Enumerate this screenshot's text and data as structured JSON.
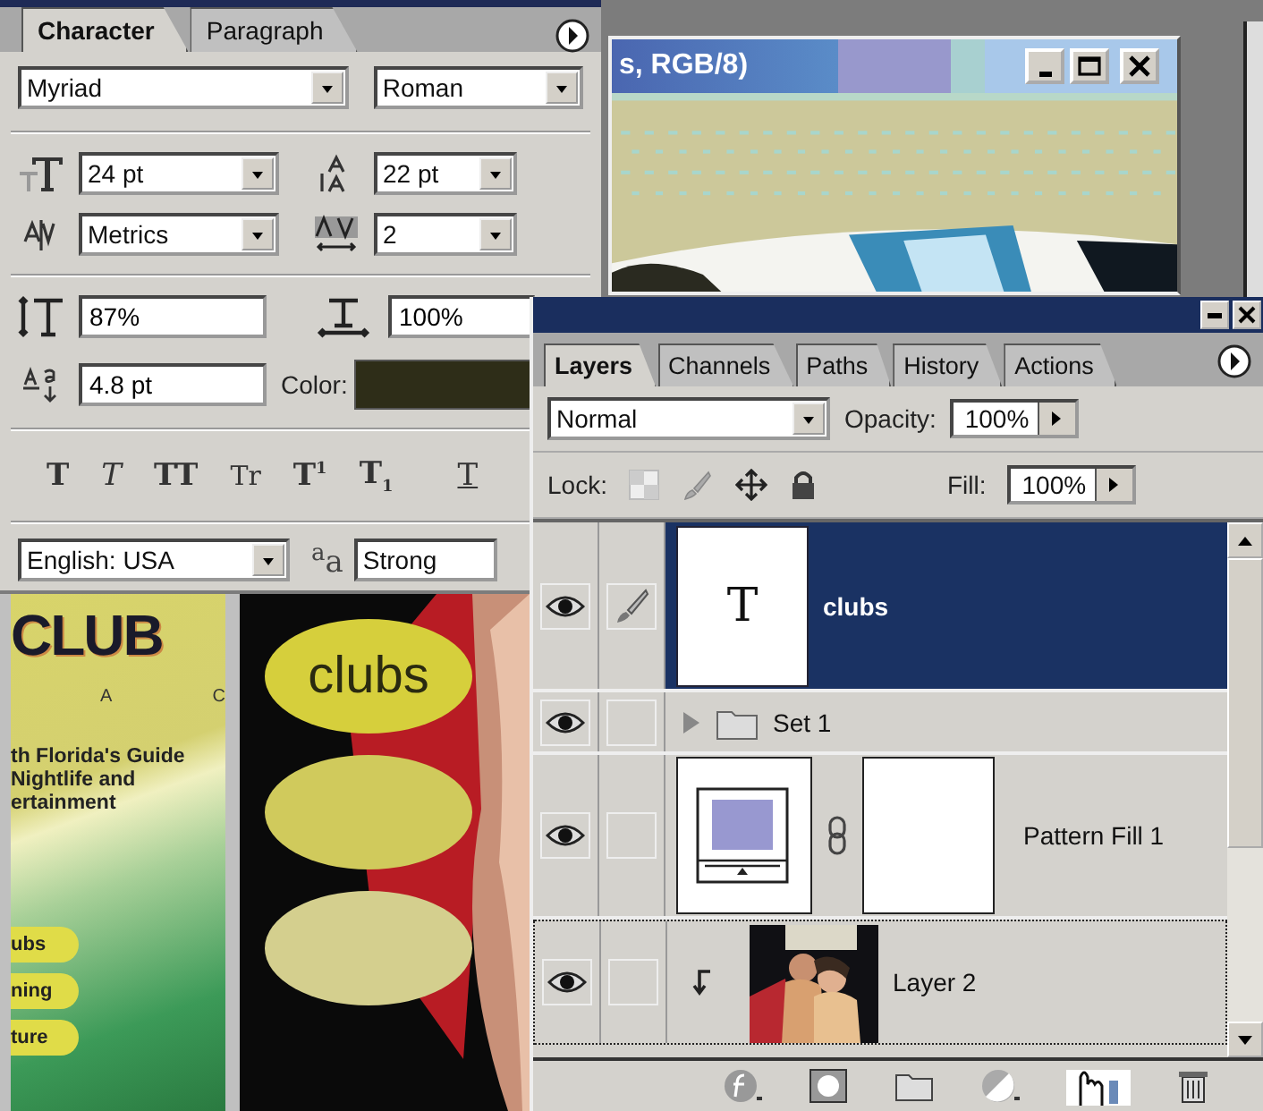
{
  "character_panel": {
    "tabs": [
      {
        "label": "Character",
        "selected": true
      },
      {
        "label": "Paragraph",
        "selected": false
      }
    ],
    "font_family": "Myriad",
    "font_style": "Roman",
    "size": "24 pt",
    "leading": "22 pt",
    "kerning": "Metrics",
    "tracking": "2",
    "vertical_scale": "87%",
    "horizontal_scale": "100%",
    "baseline_shift": "4.8 pt",
    "color_label": "Color:",
    "color": "#2e2d18",
    "style_buttons": [
      {
        "kind": "bold",
        "label": "T"
      },
      {
        "kind": "italic",
        "label": "T"
      },
      {
        "kind": "caps",
        "label": "TT"
      },
      {
        "kind": "smallcaps",
        "label": "Tr"
      },
      {
        "kind": "super",
        "label": "T$^{1}$"
      },
      {
        "kind": "sub",
        "label": "T$_{1}$"
      },
      {
        "kind": "underline",
        "label": "T"
      }
    ],
    "language": "English: USA",
    "antialias_icon": "$^{a}$a",
    "antialias": "Strong"
  },
  "document_window": {
    "title": "s, RGB/8)"
  },
  "canvas": {
    "left_page": {
      "logo": "CLUB",
      "letters": [
        "A",
        "C"
      ],
      "tagline": [
        "th Florida's Guide",
        "Nightlife and",
        "ertainment"
      ],
      "buttons": [
        "ubs",
        "ning",
        "ture"
      ]
    },
    "right_page": {
      "ovals": [
        {
          "label": "clubs",
          "color": "#d6cf3c"
        },
        {
          "color": "#d0ca5c"
        },
        {
          "color": "#d4cf8e"
        }
      ]
    }
  },
  "layers_panel": {
    "tabs": [
      {
        "label": "Layers",
        "selected": true
      },
      {
        "label": "Channels",
        "selected": false
      },
      {
        "label": "Paths",
        "selected": false
      },
      {
        "label": "History",
        "selected": false
      },
      {
        "label": "Actions",
        "selected": false
      }
    ],
    "blend_mode": "Normal",
    "opacity_label": "Opacity:",
    "opacity": "100%",
    "lock_label": "Lock:",
    "fill_label": "Fill:",
    "fill": "100%",
    "layers": [
      {
        "name": "clubs",
        "kind": "type",
        "thumb_text": "T",
        "visible": true,
        "selected": true,
        "clipped": false
      },
      {
        "name": "Set 1",
        "kind": "set",
        "visible": true,
        "selected": false,
        "expanded": false,
        "clipped": false
      },
      {
        "name": "Pattern Fill 1",
        "kind": "fill",
        "visible": true,
        "selected": false,
        "clipped": false
      },
      {
        "name": "Layer 2",
        "visible": true,
        "selected": false,
        "clipped": true
      }
    ]
  }
}
